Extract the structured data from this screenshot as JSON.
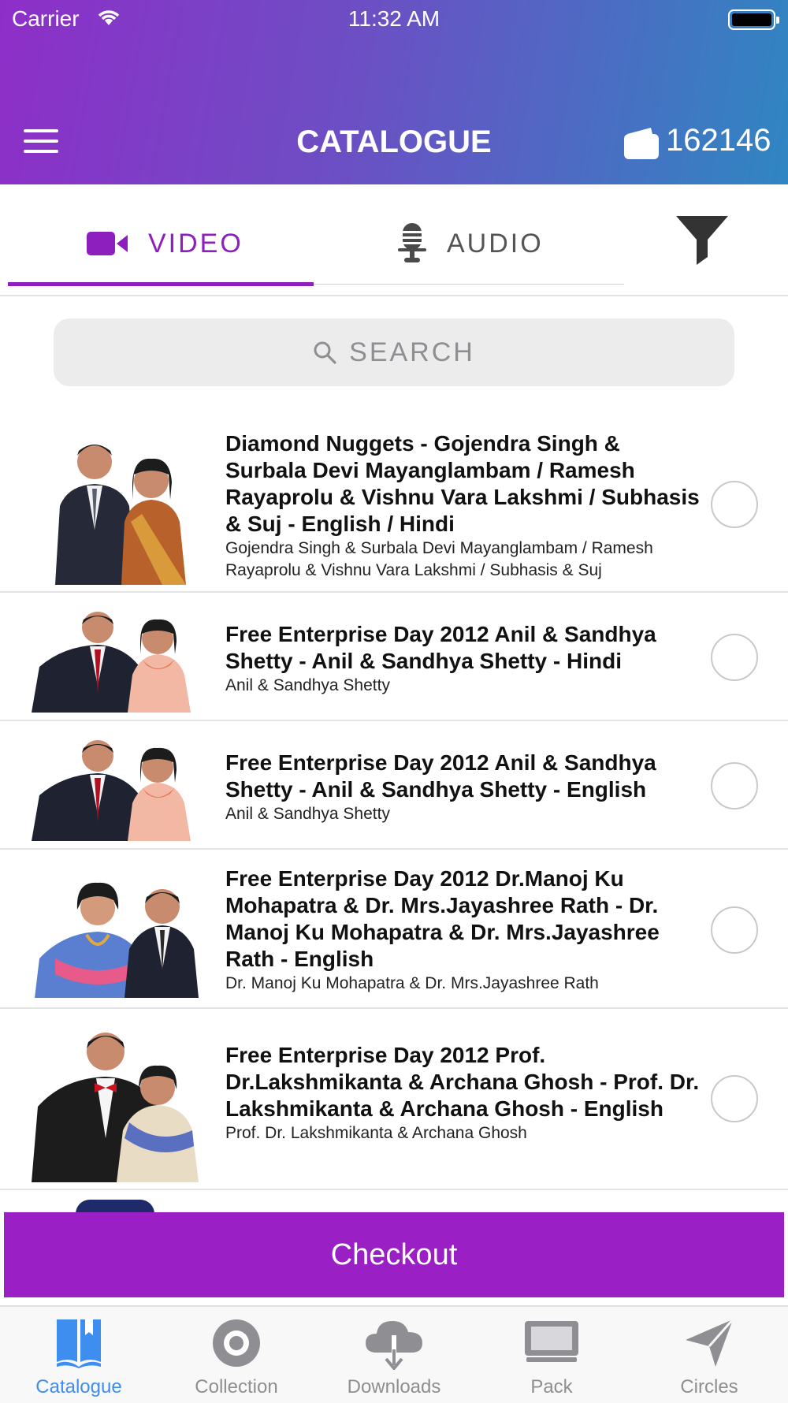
{
  "status_bar": {
    "carrier": "Carrier",
    "time": "11:32 AM"
  },
  "header": {
    "title": "CATALOGUE",
    "wallet_count": "162146"
  },
  "tabs": [
    {
      "label": "VIDEO",
      "icon": "video-camera-icon",
      "active": true
    },
    {
      "label": "AUDIO",
      "icon": "microphone-icon",
      "active": false
    }
  ],
  "search": {
    "placeholder": "SEARCH"
  },
  "items": [
    {
      "title": "Diamond Nuggets - Gojendra Singh & Surbala Devi Mayanglambam / Ramesh Rayaprolu & Vishnu Vara Lakshmi / Subhasis & Suj - English / Hindi",
      "subtitle": "Gojendra Singh & Surbala Devi Mayanglambam / Ramesh Rayaprolu & Vishnu Vara Lakshmi / Subhasis & Suj",
      "selected": false
    },
    {
      "title": "Free Enterprise Day 2012 Anil & Sandhya Shetty - Anil & Sandhya Shetty - Hindi",
      "subtitle": "Anil & Sandhya Shetty",
      "selected": false
    },
    {
      "title": "Free Enterprise Day 2012 Anil & Sandhya Shetty - Anil & Sandhya Shetty - English",
      "subtitle": "Anil & Sandhya Shetty",
      "selected": false
    },
    {
      "title": "Free Enterprise Day 2012 Dr.Manoj Ku Mohapatra & Dr. Mrs.Jayashree Rath - Dr. Manoj Ku Mohapatra & Dr. Mrs.Jayashree Rath - English",
      "subtitle": "Dr. Manoj Ku Mohapatra & Dr. Mrs.Jayashree Rath",
      "selected": false
    },
    {
      "title": "Free Enterprise Day 2012 Prof. Dr.Lakshmikanta & Archana Ghosh - Prof. Dr. Lakshmikanta & Archana Ghosh - English",
      "subtitle": "Prof. Dr. Lakshmikanta & Archana Ghosh",
      "selected": false
    }
  ],
  "checkout": {
    "label": "Checkout"
  },
  "bottom_nav": [
    {
      "label": "Catalogue",
      "icon": "book-icon",
      "active": true
    },
    {
      "label": "Collection",
      "icon": "disc-icon",
      "active": false
    },
    {
      "label": "Downloads",
      "icon": "cloud-download-icon",
      "active": false
    },
    {
      "label": "Pack",
      "icon": "monitor-icon",
      "active": false
    },
    {
      "label": "Circles",
      "icon": "paper-plane-icon",
      "active": false
    }
  ],
  "colors": {
    "accent": "#8e1fbf",
    "checkout": "#9a1fc4",
    "nav_active": "#3e8ef0",
    "nav_inactive": "#8e8e93"
  }
}
